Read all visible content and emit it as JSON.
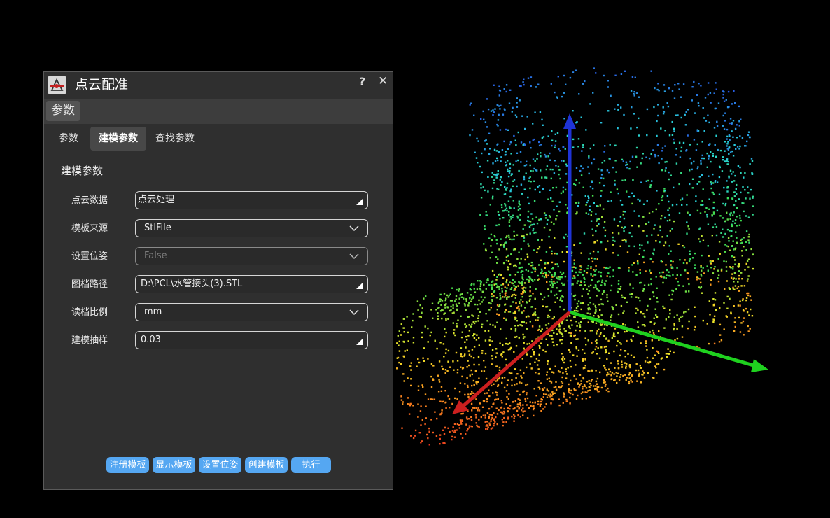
{
  "dialog": {
    "title": "点云配准",
    "help_label": "?",
    "close_label": "✕",
    "group_tab_label": "参数"
  },
  "tabs": [
    {
      "label": "参数",
      "active": false
    },
    {
      "label": "建模参数",
      "active": true
    },
    {
      "label": "查找参数",
      "active": false
    }
  ],
  "section": {
    "title": "建模参数"
  },
  "fields": {
    "point_cloud": {
      "label": "点云数据",
      "value": "点云处理"
    },
    "template_source": {
      "label": "模板来源",
      "value": "StlFile"
    },
    "set_pose": {
      "label": "设置位姿",
      "value": "False"
    },
    "file_path": {
      "label": "图档路径",
      "value": "D:\\PCL\\水管接头(3).STL"
    },
    "read_scale": {
      "label": "读档比例",
      "value": "mm"
    },
    "sampling": {
      "label": "建模抽样",
      "value": "0.03"
    }
  },
  "buttons": {
    "register_template": "注册模板",
    "show_template": "显示模板",
    "set_pose": "设置位姿",
    "create_template": "创建模板",
    "execute": "执行"
  },
  "colors": {
    "accent_button": "#55a7f2",
    "axis_x": "#cc1f1f",
    "axis_y": "#1fd11f",
    "axis_z": "#1f33d6"
  }
}
